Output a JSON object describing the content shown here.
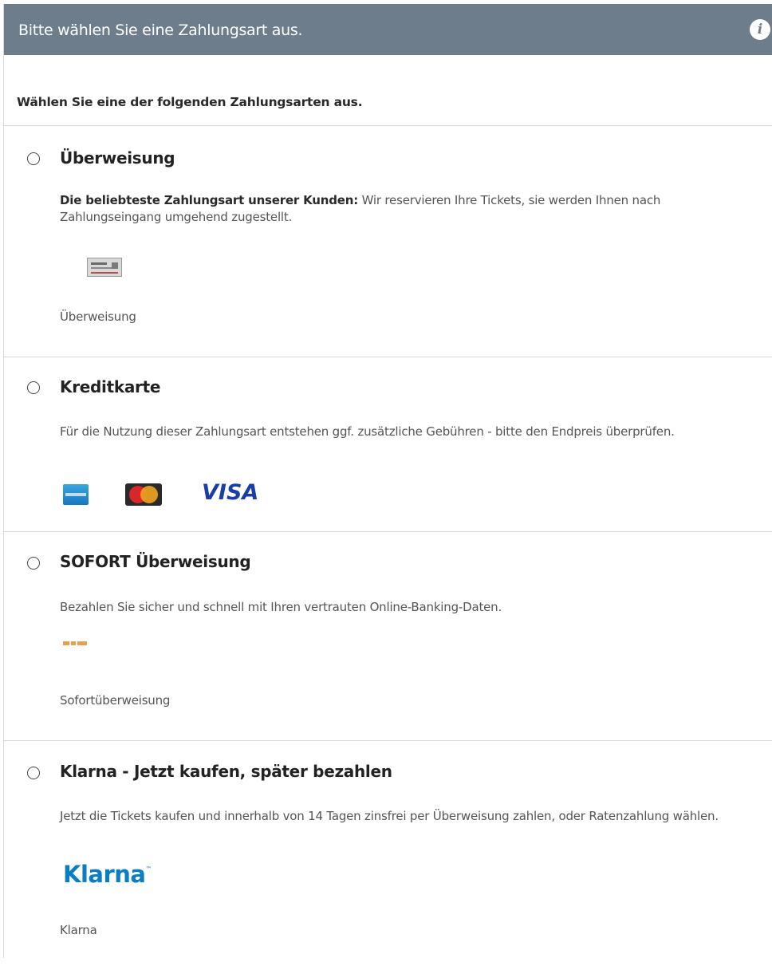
{
  "header": {
    "title": "Bitte wählen Sie eine Zahlungsart aus.",
    "info_icon": "i"
  },
  "intro": {
    "text": "Wählen Sie eine der folgenden Zahlungsarten aus."
  },
  "options": [
    {
      "title": "Überweisung",
      "desc_bold": "Die beliebteste Zahlungsart unserer Kunden:",
      "desc": " Wir reservieren Ihre Tickets, sie werden Ihnen nach Zahlungseingang umgehend zugestellt.",
      "icon": "bank-transfer-icon",
      "caption": "Überweisung",
      "selected": false
    },
    {
      "title": "Kreditkarte",
      "desc": "Für die Nutzung dieser Zahlungsart entstehen ggf. zusätzliche Gebühren - bitte den Endpreis überprüfen.",
      "icons": [
        "amex-icon",
        "mastercard-icon",
        "visa-logo"
      ],
      "visa_text": "VISA",
      "selected": false
    },
    {
      "title": "SOFORT Überweisung",
      "desc": "Bezahlen Sie sicher und schnell mit Ihren vertrauten Online-Banking-Daten.",
      "icon": "sofort-icon",
      "caption": "Sofortüberweisung",
      "selected": false
    },
    {
      "title": "Klarna - Jetzt kaufen, später bezahlen",
      "desc": "Jetzt die Tickets kaufen und innerhalb von 14 Tagen zinsfrei per Überweisung zahlen, oder Ratenzahlung wählen.",
      "logo_text": "Klarna",
      "logo_mark": "™",
      "caption": "Klarna",
      "selected": false
    }
  ],
  "colors": {
    "header_bg": "#6d7d8c",
    "klarna_blue": "#0a7ec2",
    "visa_blue": "#1a3ea8"
  }
}
